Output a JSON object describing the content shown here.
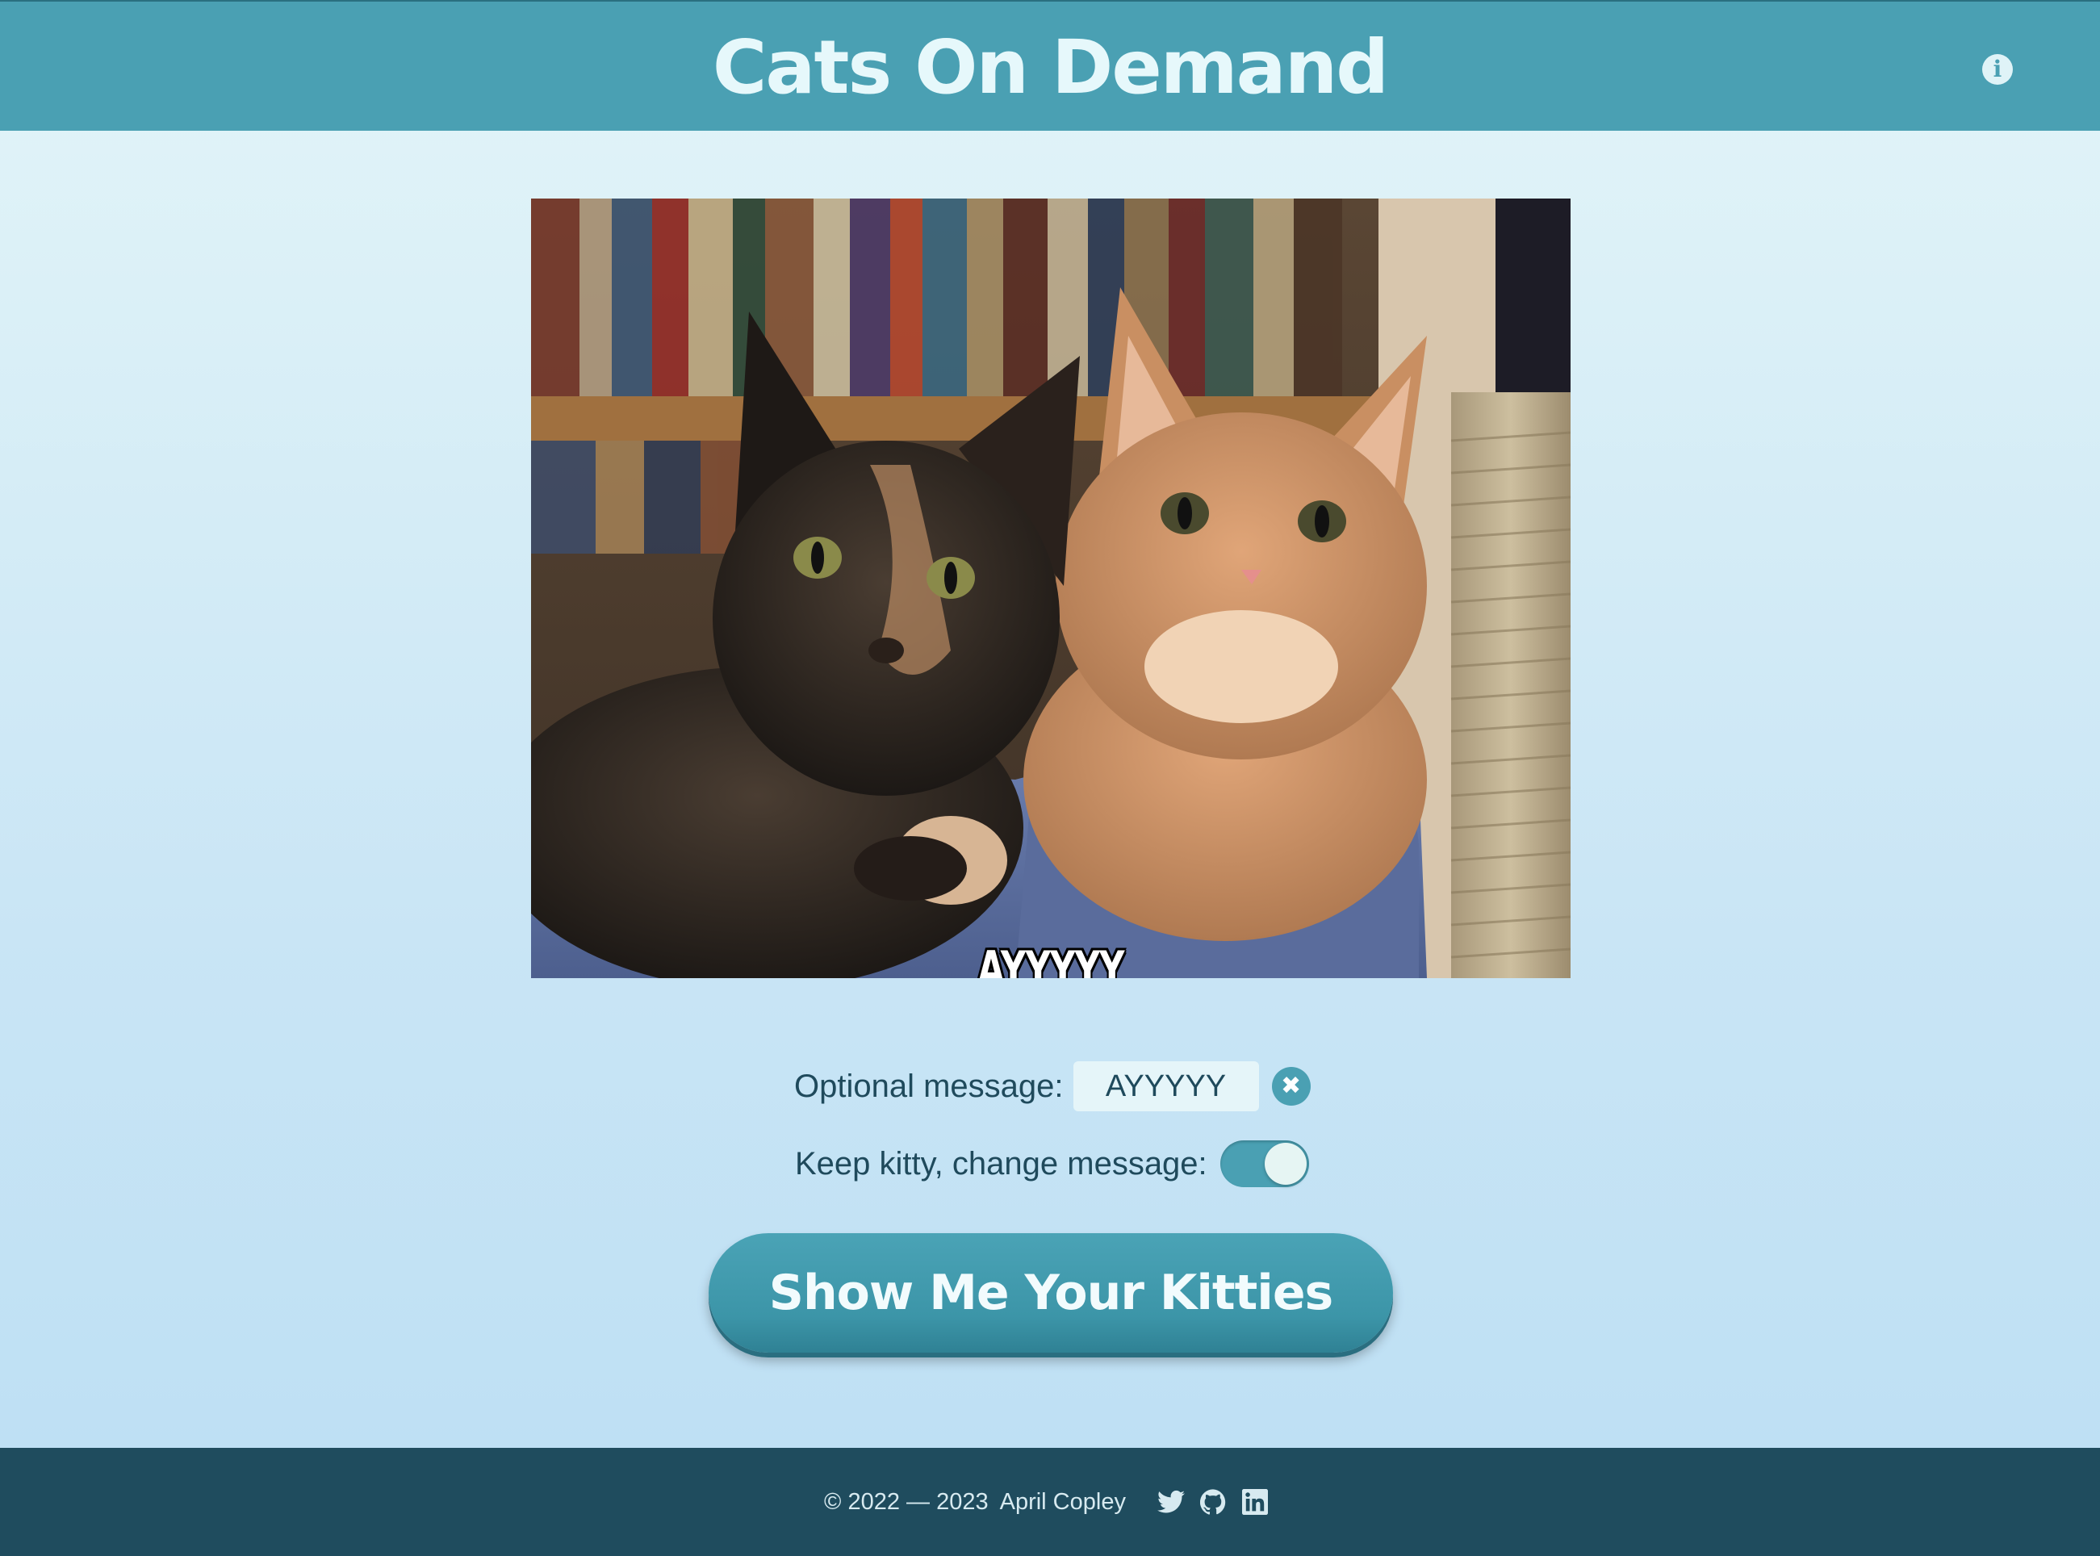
{
  "header": {
    "title": "Cats On Demand",
    "info_icon": "info-circle-icon",
    "info_glyph": "i"
  },
  "photo": {
    "caption": "AYYYYY"
  },
  "form": {
    "message_label": "Optional message:",
    "message_value": "AYYYYY",
    "clear_icon": "close-circle-icon",
    "clear_glyph": "✖",
    "keep_label": "Keep kitty, change message:",
    "keep_enabled": true
  },
  "cta": {
    "label": "Show Me Your Kitties"
  },
  "footer": {
    "years": "© 2022 — 2023",
    "author": "April Copley",
    "social_icons": [
      "twitter-icon",
      "github-icon",
      "linkedin-icon"
    ]
  },
  "colors": {
    "header_bg": "#4aa0b3",
    "accent": "#4aa0b3",
    "footer_bg": "#1f4c5e",
    "text_dark": "#1f4a5c"
  }
}
